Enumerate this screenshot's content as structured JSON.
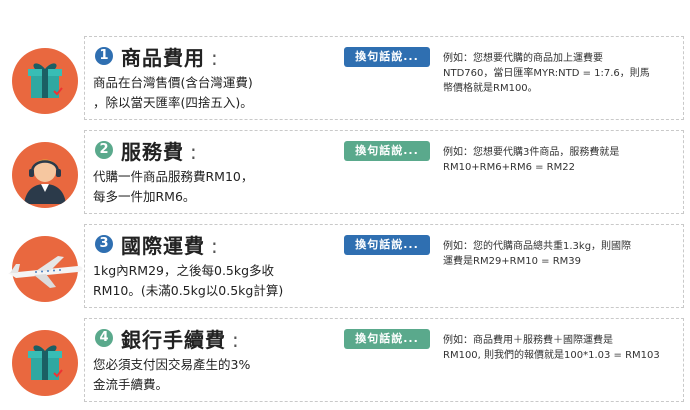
{
  "colors": {
    "circle": "#e9683f",
    "blue": "#2f6fb1",
    "green": "#5aa98c",
    "gift": "#2fa8a1",
    "ribbon": "#1b5f64"
  },
  "items": [
    {
      "number": "1",
      "title": "商品費用",
      "colon": ":",
      "icon": "gift-icon",
      "desc": "商品在台灣售價(含台灣運費)\n，除以當天匯率(四捨五入)。",
      "button": "換句話說...",
      "button_color": "blue",
      "example": "例如：您想要代購的商品加上運費要\nNTD760，當日匯率MYR:NTD = 1:7.6，則馬\n幣價格就是RM100。"
    },
    {
      "number": "2",
      "title": "服務費",
      "colon": ":",
      "icon": "agent-icon",
      "desc": "代購一件商品服務費RM10，\n每多一件加RM6。",
      "button": "換句話說...",
      "button_color": "green",
      "example": "例如：您想要代購3件商品，服務費就是\nRM10+RM6+RM6 = RM22"
    },
    {
      "number": "3",
      "title": "國際運費",
      "colon": ":",
      "icon": "airplane-icon",
      "desc": "1kg內RM29，之後每0.5kg多收\nRM10。(未滿0.5kg以0.5kg計算)",
      "button": "換句話說...",
      "button_color": "blue",
      "example": "例如：您的代購商品總共重1.3kg，則國際\n運費是RM29+RM10 = RM39"
    },
    {
      "number": "4",
      "title": "銀行手續費",
      "colon": ":",
      "icon": "gift-icon",
      "desc": "您必須支付因交易產生的3%\n金流手續費。",
      "button": "換句話說...",
      "button_color": "green",
      "example": "例如：商品費用＋服務費＋國際運費是\nRM100, 則我們的報價就是100*1.03 = RM103"
    }
  ]
}
